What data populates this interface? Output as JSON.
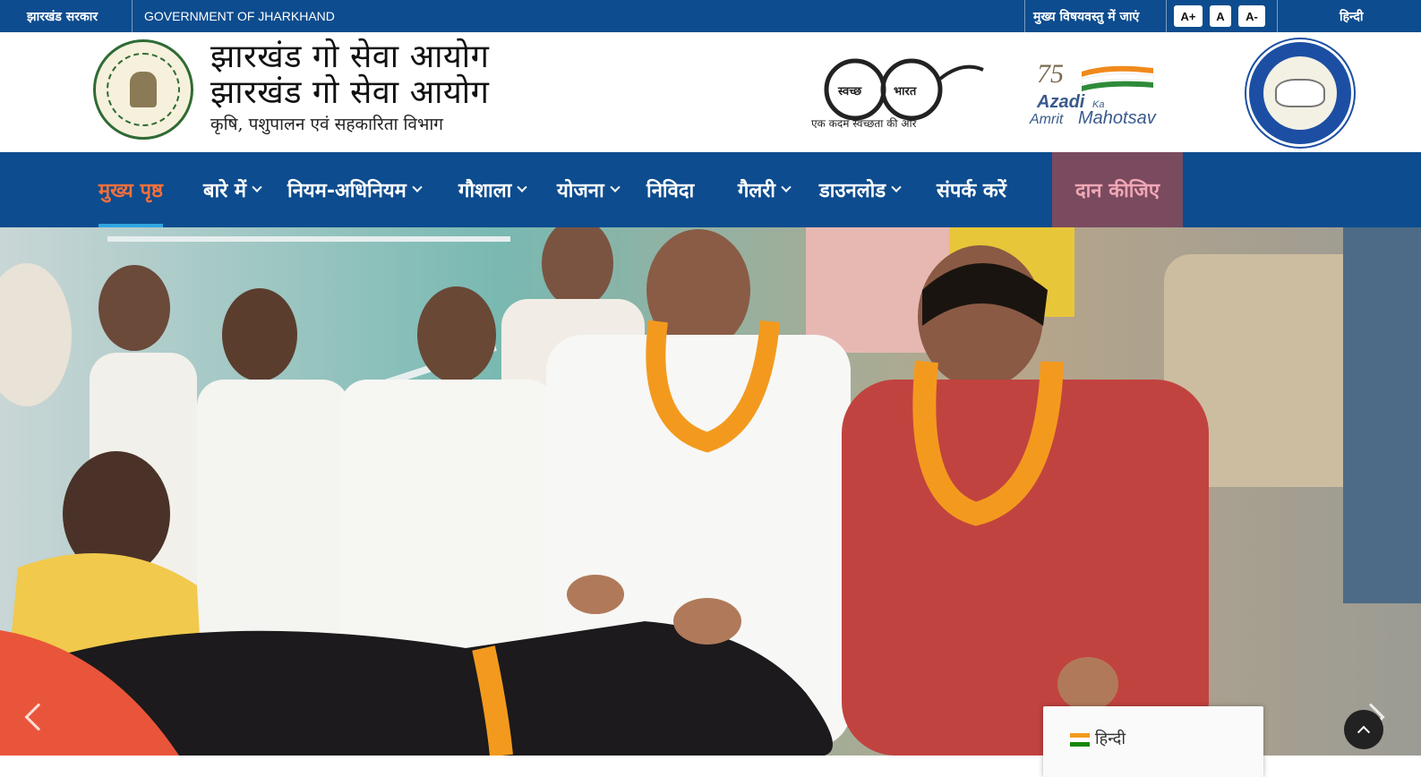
{
  "topbar": {
    "state_gov_hindi": "झारखंड सरकार",
    "state_gov_english": "GOVERNMENT OF JHARKHAND",
    "skip_to_content": "मुख्य विषयवस्तु में जाएं",
    "font_increase": "A+",
    "font_normal": "A",
    "font_decrease": "A-",
    "language": "हिन्दी"
  },
  "header": {
    "title_line1": "झारखंड गो सेवा आयोग",
    "title_line2": "झारखंड गो सेवा आयोग",
    "subtitle": "कृषि, पशुपालन एवं सहकारिता विभाग",
    "swachh_left": "स्वच्छ",
    "swachh_right": "भारत",
    "swachh_caption": "एक कदम स्वच्छता की ओर",
    "azadi_number": "75",
    "azadi_word1": "Azadi",
    "azadi_word2": "Ka",
    "azadi_word3": "Amrit",
    "azadi_word4": "Mahotsav"
  },
  "nav": {
    "items": [
      {
        "label": "मुख्य पृष्ठ",
        "active": true,
        "dropdown": false
      },
      {
        "label": "बारे में",
        "active": false,
        "dropdown": true
      },
      {
        "label": "नियम-अधिनियम",
        "active": false,
        "dropdown": true
      },
      {
        "label": "गौशाला",
        "active": false,
        "dropdown": true
      },
      {
        "label": "योजना",
        "active": false,
        "dropdown": true
      },
      {
        "label": "निविदा",
        "active": false,
        "dropdown": false
      },
      {
        "label": "गैलरी",
        "active": false,
        "dropdown": true
      },
      {
        "label": "डाउनलोड",
        "active": false,
        "dropdown": true
      },
      {
        "label": "संपर्क करें",
        "active": false,
        "dropdown": false
      }
    ],
    "donate": "दान कीजिए"
  },
  "language_widget": {
    "label": "हिन्दी"
  },
  "colors": {
    "primary_blue": "#0d4c8e",
    "active_orange": "#f2703c",
    "donate_bg": "#7a4b5f"
  },
  "icons": {
    "carousel_prev": "chevron-left-icon",
    "carousel_next": "chevron-right-icon",
    "back_to_top": "chevron-up-icon",
    "language_flag": "india-flag-icon"
  }
}
